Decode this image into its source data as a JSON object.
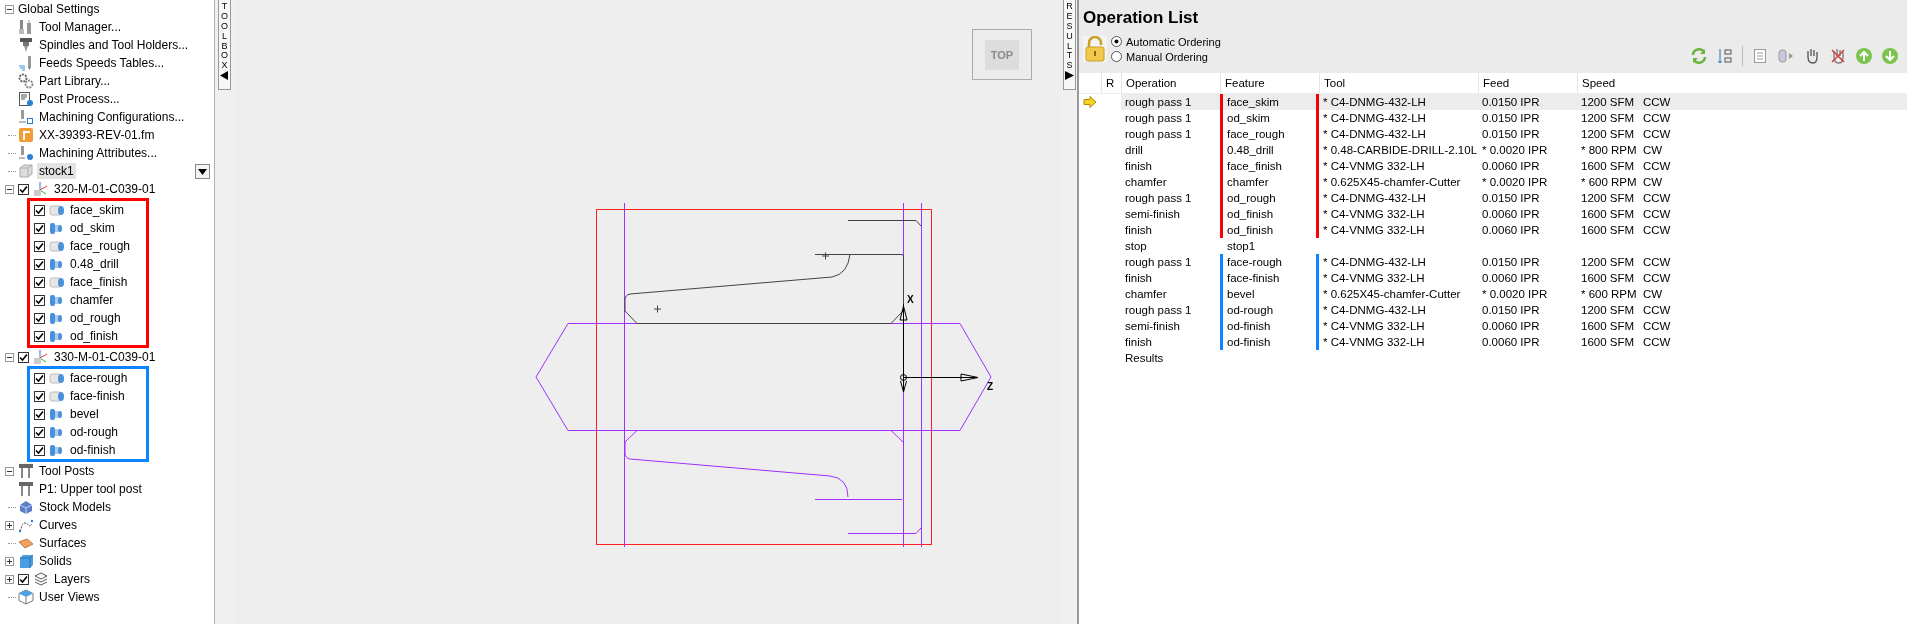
{
  "tree": [
    {
      "label": "Global Settings",
      "expanded": true,
      "selected": false,
      "children": [
        {
          "label": "Tool Manager...",
          "kind": "tool",
          "selected": false
        },
        {
          "label": "Spindles and Tool Holders...",
          "kind": "spindle",
          "selected": false
        },
        {
          "label": "Feeds  Speeds Tables...",
          "kind": "feeds",
          "selected": false
        },
        {
          "label": "Part Library...",
          "kind": "library",
          "selected": false
        },
        {
          "label": "Post Process...",
          "kind": "post",
          "selected": false
        },
        {
          "label": "Machining Configurations...",
          "kind": "config",
          "selected": false
        }
      ]
    },
    {
      "label": "XX-39393-REV-01.fm",
      "kind": "file",
      "selected": false
    },
    {
      "label": "Machining Attributes...",
      "kind": "attributes",
      "selected": false
    },
    {
      "label": "stock1",
      "kind": "stock",
      "selected": true,
      "dropdown": true
    },
    {
      "label": "320-M-01-C039-01",
      "kind": "setup",
      "expanded": true,
      "checked": true,
      "selected": false,
      "color": "#ff0000",
      "children": [
        {
          "label": "face_skim",
          "kind": "face",
          "checked": true,
          "selected": false
        },
        {
          "label": "od_skim",
          "kind": "od",
          "checked": true,
          "selected": false
        },
        {
          "label": "face_rough",
          "kind": "face",
          "checked": true,
          "selected": false
        },
        {
          "label": "0.48_drill",
          "kind": "od",
          "checked": true,
          "selected": false
        },
        {
          "label": "face_finish",
          "kind": "face",
          "checked": true,
          "selected": false
        },
        {
          "label": "chamfer",
          "kind": "od",
          "checked": true,
          "selected": false
        },
        {
          "label": "od_rough",
          "kind": "od",
          "checked": true,
          "selected": false
        },
        {
          "label": "od_finish",
          "kind": "od",
          "checked": true,
          "selected": false
        }
      ]
    },
    {
      "label": "330-M-01-C039-01",
      "kind": "setup",
      "expanded": true,
      "checked": true,
      "selected": false,
      "color": "#0a84ff",
      "children": [
        {
          "label": "face-rough",
          "kind": "face",
          "checked": true,
          "selected": false
        },
        {
          "label": "face-finish",
          "kind": "face",
          "checked": true,
          "selected": false
        },
        {
          "label": "bevel",
          "kind": "od",
          "checked": true,
          "selected": false
        },
        {
          "label": "od-rough",
          "kind": "od",
          "checked": true,
          "selected": false
        },
        {
          "label": "od-finish",
          "kind": "od",
          "checked": true,
          "selected": false
        }
      ]
    },
    {
      "label": "Tool Posts",
      "kind": "toolpost",
      "expanded": true,
      "selected": false,
      "children": [
        {
          "label": "P1: Upper tool post",
          "kind": "toolpost",
          "selected": false
        }
      ]
    },
    {
      "label": "Stock Models",
      "kind": "stockmodels",
      "selected": false
    },
    {
      "label": "Curves",
      "kind": "curve",
      "expanded": false,
      "selected": false
    },
    {
      "label": "Surfaces",
      "kind": "surface",
      "selected": false
    },
    {
      "label": "Solids",
      "kind": "solid",
      "expanded": false,
      "selected": false
    },
    {
      "label": "Layers",
      "kind": "layers",
      "expanded": false,
      "checked": true,
      "selected": false
    },
    {
      "label": "User Views",
      "kind": "views",
      "selected": false
    }
  ],
  "toolbox_tab": "TOOLBOX",
  "viewport": {
    "view_button": "TOP",
    "axis_labels": [
      "X",
      "Z"
    ]
  },
  "results_tab": "RESULTS",
  "operation_list": {
    "title": "Operation List",
    "ordering": [
      {
        "label": "Automatic Ordering",
        "selected": true
      },
      {
        "label": "Manual Ordering",
        "selected": false
      }
    ],
    "columns": [
      "R",
      "Operation",
      "Feature",
      "Tool",
      "Feed",
      "Speed"
    ],
    "rows": [
      {
        "operation": "rough pass 1",
        "feature": "face_skim",
        "tool": "* C4-DNMG-432-LH",
        "feed": "0.0150 IPR",
        "speed": "1200 SFM",
        "direction": "CCW",
        "selected": true,
        "current": true,
        "color": "#ff0000"
      },
      {
        "operation": "rough pass 1",
        "feature": "od_skim",
        "tool": "* C4-DNMG-432-LH",
        "feed": "0.0150 IPR",
        "speed": "1200 SFM",
        "direction": "CCW",
        "selected": false,
        "current": false,
        "color": "#ff0000"
      },
      {
        "operation": "rough pass 1",
        "feature": "face_rough",
        "tool": "* C4-DNMG-432-LH",
        "feed": "0.0150 IPR",
        "speed": "1200 SFM",
        "direction": "CCW",
        "selected": false,
        "current": false,
        "color": "#ff0000"
      },
      {
        "operation": "drill",
        "feature": "0.48_drill",
        "tool": "* 0.48-CARBIDE-DRILL-2.10L",
        "feed": "* 0.0020 IPR",
        "speed": "* 800 RPM",
        "direction": "CW",
        "selected": false,
        "current": false,
        "color": "#ff0000"
      },
      {
        "operation": "finish",
        "feature": "face_finish",
        "tool": "* C4-VNMG 332-LH",
        "feed": "0.0060 IPR",
        "speed": "1600 SFM",
        "direction": "CCW",
        "selected": false,
        "current": false,
        "color": "#ff0000"
      },
      {
        "operation": "chamfer",
        "feature": "chamfer",
        "tool": "* 0.625X45-chamfer-Cutter",
        "feed": "* 0.0020 IPR",
        "speed": "* 600 RPM",
        "direction": "CW",
        "selected": false,
        "current": false,
        "color": "#ff0000"
      },
      {
        "operation": "rough pass 1",
        "feature": "od_rough",
        "tool": "* C4-DNMG-432-LH",
        "feed": "0.0150 IPR",
        "speed": "1200 SFM",
        "direction": "CCW",
        "selected": false,
        "current": false,
        "color": "#ff0000"
      },
      {
        "operation": "semi-finish",
        "feature": "od_finish",
        "tool": "* C4-VNMG 332-LH",
        "feed": "0.0060 IPR",
        "speed": "1600 SFM",
        "direction": "CCW",
        "selected": false,
        "current": false,
        "color": "#ff0000"
      },
      {
        "operation": "finish",
        "feature": "od_finish",
        "tool": "* C4-VNMG 332-LH",
        "feed": "0.0060 IPR",
        "speed": "1600 SFM",
        "direction": "CCW",
        "selected": false,
        "current": false,
        "color": "#ff0000"
      },
      {
        "operation": "stop",
        "feature": "stop1",
        "selected": false,
        "current": false
      },
      {
        "operation": "rough pass 1",
        "feature": "face-rough",
        "tool": "* C4-DNMG-432-LH",
        "feed": "0.0150 IPR",
        "speed": "1200 SFM",
        "direction": "CCW",
        "selected": false,
        "current": false,
        "color": "#0a84ff"
      },
      {
        "operation": "finish",
        "feature": "face-finish",
        "tool": "* C4-VNMG 332-LH",
        "feed": "0.0060 IPR",
        "speed": "1600 SFM",
        "direction": "CCW",
        "selected": false,
        "current": false,
        "color": "#0a84ff"
      },
      {
        "operation": "chamfer",
        "feature": "bevel",
        "tool": "* 0.625X45-chamfer-Cutter",
        "feed": "* 0.0020 IPR",
        "speed": "* 600 RPM",
        "direction": "CW",
        "selected": false,
        "current": false,
        "color": "#0a84ff"
      },
      {
        "operation": "rough pass 1",
        "feature": "od-rough",
        "tool": "* C4-DNMG-432-LH",
        "feed": "0.0150 IPR",
        "speed": "1200 SFM",
        "direction": "CCW",
        "selected": false,
        "current": false,
        "color": "#0a84ff"
      },
      {
        "operation": "semi-finish",
        "feature": "od-finish",
        "tool": "* C4-VNMG 332-LH",
        "feed": "0.0060 IPR",
        "speed": "1600 SFM",
        "direction": "CCW",
        "selected": false,
        "current": false,
        "color": "#0a84ff"
      },
      {
        "operation": "finish",
        "feature": "od-finish",
        "tool": "* C4-VNMG 332-LH",
        "feed": "0.0060 IPR",
        "speed": "1600 SFM",
        "direction": "CCW",
        "selected": false,
        "current": false,
        "color": "#0a84ff"
      },
      {
        "operation": "Results",
        "selected": false,
        "current": false
      }
    ]
  }
}
